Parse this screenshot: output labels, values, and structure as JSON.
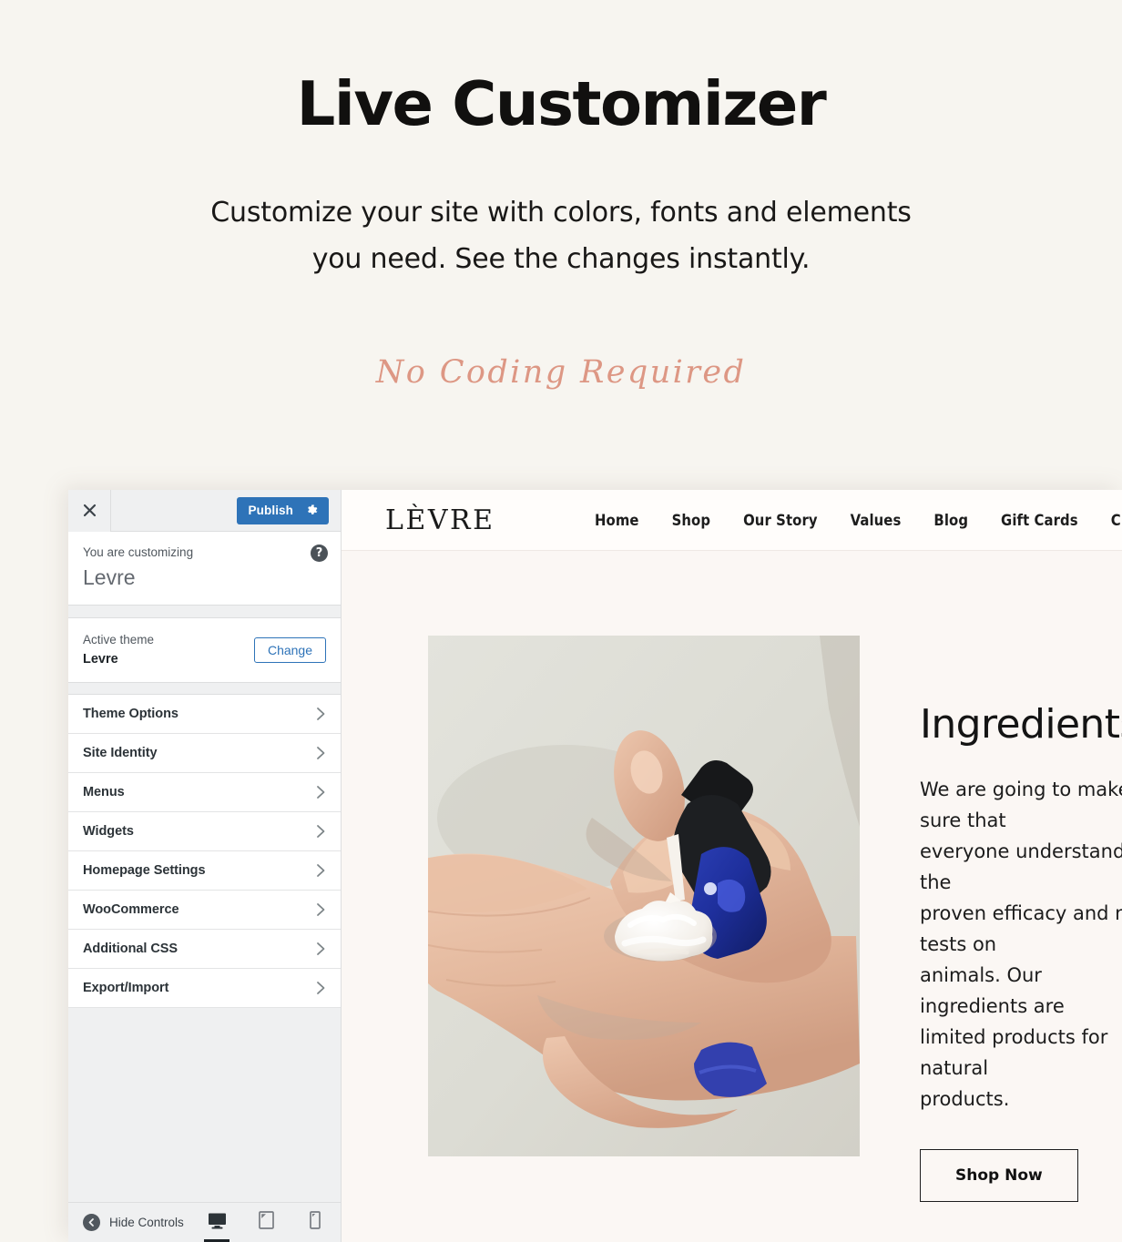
{
  "hero": {
    "title": "Live Customizer",
    "subtitle": "Customize your site with colors, fonts and elements you need. See the changes instantly.",
    "script_text": "No Coding Required",
    "accent_color": "#dd9784",
    "background_color": "#f7f5f0"
  },
  "customizer": {
    "topbar": {
      "close_icon": "close-icon",
      "publish_label": "Publish",
      "publish_color": "#2e73b8",
      "settings_icon": "gear-icon"
    },
    "customizing": {
      "label": "You are customizing",
      "site_name": "Levre",
      "help_icon": "help-icon",
      "help_glyph": "?"
    },
    "active_theme": {
      "label": "Active theme",
      "name": "Levre",
      "change_label": "Change"
    },
    "nav_items": [
      {
        "label": "Theme Options"
      },
      {
        "label": "Site Identity"
      },
      {
        "label": "Menus"
      },
      {
        "label": "Widgets"
      },
      {
        "label": "Homepage Settings"
      },
      {
        "label": "WooCommerce"
      },
      {
        "label": "Additional CSS"
      },
      {
        "label": "Export/Import"
      }
    ],
    "footer": {
      "hide_controls_label": "Hide Controls",
      "devices": [
        {
          "name": "desktop",
          "active": true
        },
        {
          "name": "tablet",
          "active": false
        },
        {
          "name": "mobile",
          "active": false
        }
      ]
    }
  },
  "preview": {
    "background_color": "#fbf7f4",
    "site_logo": "LÈVRE",
    "nav": [
      {
        "label": "Home"
      },
      {
        "label": "Shop"
      },
      {
        "label": "Our Story"
      },
      {
        "label": "Values"
      },
      {
        "label": "Blog"
      },
      {
        "label": "Gift Cards"
      },
      {
        "label": "C"
      }
    ],
    "content": {
      "heading": "Ingredients",
      "body": "We are going to make sure that\neveryone understands the\nproven efficacy and no tests on\nanimals. Our ingredients are\nlimited products for natural\nproducts.",
      "button_label": "Shop Now"
    },
    "photo_alt": "hands-dispensing-lotion-from-blue-bottle"
  }
}
